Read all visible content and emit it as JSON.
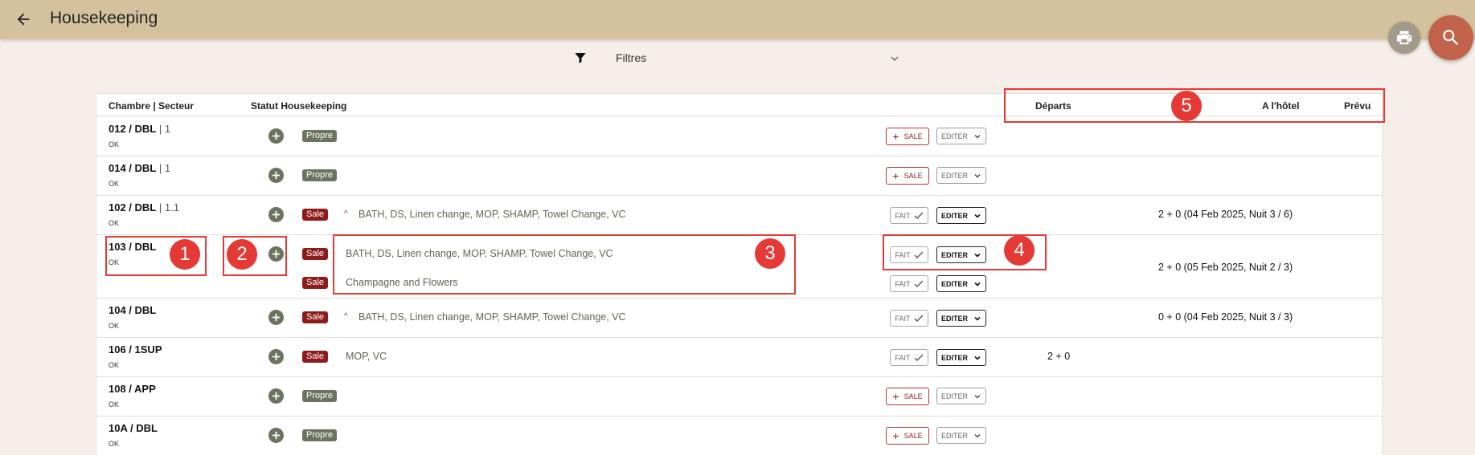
{
  "header": {
    "title": "Housekeeping"
  },
  "filter": {
    "label": "Filtres"
  },
  "table": {
    "columns": {
      "room": "Chambre | Secteur",
      "status": "Statut Housekeeping",
      "departures": "Départs",
      "at_hotel": "A l'hôtel",
      "expected": "Prévu"
    },
    "rows": [
      {
        "room": "012 / DBL",
        "sep": " | ",
        "sector": "1",
        "ok": "OK",
        "badge": "Propre",
        "tasks": "",
        "action": "+ SALE",
        "edit": "EDITER",
        "departures": "",
        "at_hotel": ""
      },
      {
        "room": "014 / DBL",
        "sep": " | ",
        "sector": "1",
        "ok": "OK",
        "badge": "Propre",
        "tasks": "",
        "action": "+ SALE",
        "edit": "EDITER",
        "departures": "",
        "at_hotel": ""
      },
      {
        "room": "102 / DBL",
        "sep": " | ",
        "sector": "1.1",
        "ok": "OK",
        "badge": "Sale",
        "caret": "^",
        "tasks": "BATH, DS, Linen change, MOP, SHAMP, Towel Change, VC",
        "action": "FAIT",
        "edit": "EDITER",
        "departures": "",
        "at_hotel": "2 + 0 (04 Feb 2025, Nuit 3 / 6)"
      },
      {
        "room": "103 / DBL",
        "ok": "OK",
        "lines": [
          {
            "badge": "Sale",
            "tasks": "BATH, DS, Linen change, MOP, SHAMP, Towel Change, VC",
            "action": "FAIT",
            "edit": "EDITER"
          },
          {
            "badge": "Sale",
            "tasks": "Champagne and Flowers",
            "action": "FAIT",
            "edit": "EDITER"
          }
        ],
        "departures": "",
        "at_hotel": "2 + 0 (05 Feb 2025, Nuit 2 / 3)"
      },
      {
        "room": "104 / DBL",
        "ok": "OK",
        "badge": "Sale",
        "caret": "^",
        "tasks": "BATH, DS, Linen change, MOP, SHAMP, Towel Change, VC",
        "action": "FAIT",
        "edit": "EDITER",
        "departures": "",
        "at_hotel": "0 + 0 (04 Feb 2025, Nuit 3 / 3)"
      },
      {
        "room": "106 / 1SUP",
        "ok": "OK",
        "badge": "Sale",
        "tasks": "MOP, VC",
        "action": "FAIT",
        "edit": "EDITER",
        "departures": "2 + 0",
        "at_hotel": ""
      },
      {
        "room": "108 / APP",
        "ok": "OK",
        "badge": "Propre",
        "tasks": "",
        "action": "+ SALE",
        "edit": "EDITER",
        "departures": "",
        "at_hotel": ""
      },
      {
        "room": "10A / DBL",
        "ok": "OK",
        "badge": "Propre",
        "tasks": "",
        "action": "+ SALE",
        "edit": "EDITER",
        "departures": "",
        "at_hotel": ""
      }
    ]
  },
  "actions": {
    "sale_label": "SALE",
    "fait_label": "FAIT"
  },
  "annotations": [
    "1",
    "2",
    "3",
    "4",
    "5"
  ],
  "icons": {
    "back": "arrow-left-icon",
    "print": "print-icon",
    "search": "search-icon",
    "filter": "filter-icon"
  },
  "colors": {
    "topbar": "#d4c19d",
    "background": "#f6efe9",
    "propre": "#6c745f",
    "sale": "#8e1c1c",
    "search_fab": "#c0634a",
    "annotation": "#e53935"
  }
}
